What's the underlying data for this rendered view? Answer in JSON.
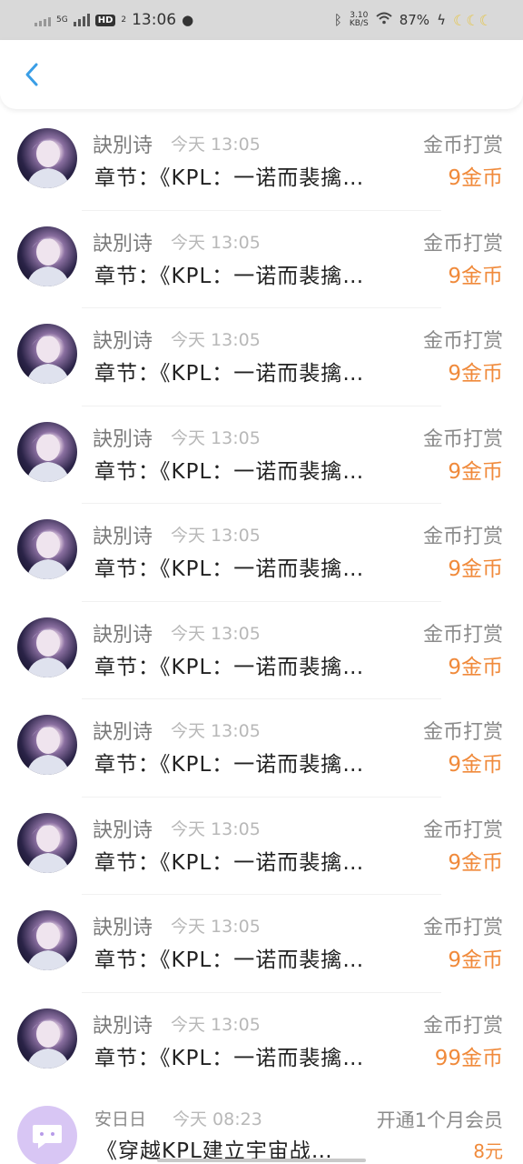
{
  "status_bar": {
    "net": "5G",
    "hd": "HD",
    "hd_sub": "2",
    "time": "13:06",
    "speed_value": "3.10",
    "speed_unit": "KB/S",
    "battery": "87%",
    "icons": [
      "signal-icon",
      "wechat-icon",
      "bluetooth-icon",
      "wifi-icon",
      "charging-icon",
      "moon-icon"
    ]
  },
  "header": {
    "back_icon": "back-arrow-icon"
  },
  "records": [
    {
      "name": "訣別诗",
      "time": "今天 13:05",
      "chapter": "章节：《KPL：一诺而裴擒…",
      "type": "金币打赏",
      "amount": "9金币"
    },
    {
      "name": "訣別诗",
      "time": "今天 13:05",
      "chapter": "章节：《KPL：一诺而裴擒…",
      "type": "金币打赏",
      "amount": "9金币"
    },
    {
      "name": "訣別诗",
      "time": "今天 13:05",
      "chapter": "章节：《KPL：一诺而裴擒…",
      "type": "金币打赏",
      "amount": "9金币"
    },
    {
      "name": "訣別诗",
      "time": "今天 13:05",
      "chapter": "章节：《KPL：一诺而裴擒…",
      "type": "金币打赏",
      "amount": "9金币"
    },
    {
      "name": "訣別诗",
      "time": "今天 13:05",
      "chapter": "章节：《KPL：一诺而裴擒…",
      "type": "金币打赏",
      "amount": "9金币"
    },
    {
      "name": "訣別诗",
      "time": "今天 13:05",
      "chapter": "章节：《KPL：一诺而裴擒…",
      "type": "金币打赏",
      "amount": "9金币"
    },
    {
      "name": "訣別诗",
      "time": "今天 13:05",
      "chapter": "章节：《KPL：一诺而裴擒…",
      "type": "金币打赏",
      "amount": "9金币"
    },
    {
      "name": "訣別诗",
      "time": "今天 13:05",
      "chapter": "章节：《KPL：一诺而裴擒…",
      "type": "金币打赏",
      "amount": "9金币"
    },
    {
      "name": "訣別诗",
      "time": "今天 13:05",
      "chapter": "章节：《KPL：一诺而裴擒…",
      "type": "金币打赏",
      "amount": "9金币"
    },
    {
      "name": "訣別诗",
      "time": "今天 13:05",
      "chapter": "章节：《KPL：一诺而裴擒…",
      "type": "金币打赏",
      "amount": "99金币"
    }
  ],
  "last_record": {
    "name": "安日日",
    "time": "今天 08:23",
    "chapter": "《穿越KPL建立宇宙战…",
    "type": "开通1个月会员",
    "amount": "8元"
  },
  "colors": {
    "accent": "#f08a3b",
    "back": "#3a9ee6",
    "avatar_bg": "#d8c6f4"
  }
}
